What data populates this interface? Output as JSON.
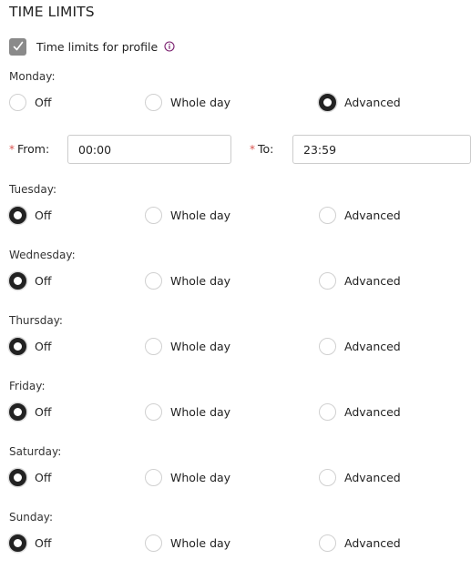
{
  "section": {
    "title": "TIME LIMITS"
  },
  "profile_toggle": {
    "label": "Time limits for profile",
    "checked": true,
    "info_icon": "info-circle-icon"
  },
  "options": [
    "Off",
    "Whole day",
    "Advanced"
  ],
  "advanced_fields": {
    "from_label": "From:",
    "from_value": "00:00",
    "to_label": "To:",
    "to_value": "23:59",
    "required_marker": "*"
  },
  "days": [
    {
      "label": "Monday:",
      "selected": "Advanced"
    },
    {
      "label": "Tuesday:",
      "selected": "Off"
    },
    {
      "label": "Wednesday:",
      "selected": "Off"
    },
    {
      "label": "Thursday:",
      "selected": "Off"
    },
    {
      "label": "Friday:",
      "selected": "Off"
    },
    {
      "label": "Saturday:",
      "selected": "Off"
    },
    {
      "label": "Sunday:",
      "selected": "Off"
    }
  ],
  "colors": {
    "accent": "#7a1f6e",
    "required": "#d9534f",
    "checkbox": "#8a8a8a",
    "radio_checked": "#222222"
  }
}
